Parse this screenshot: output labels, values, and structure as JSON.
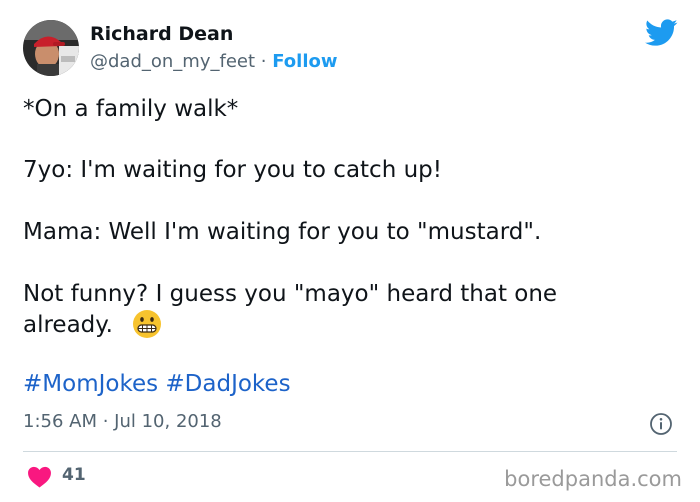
{
  "author": {
    "name": "Richard Dean",
    "handle": "@dad_on_my_feet",
    "separator": " · ",
    "follow_label": "Follow"
  },
  "tweet": {
    "lines": [
      "*On a family walk*",
      "7yo: I'm waiting for you to catch up!",
      "Mama: Well I'm waiting for you to \"mustard\".",
      "Not funny?  I guess you \"mayo\" heard that one",
      "already."
    ],
    "emoji": "grimacing-face-emoji",
    "hashtags": [
      "#MomJokes",
      "#DadJokes"
    ]
  },
  "meta": {
    "timestamp": "1:56 AM · Jul 10, 2018",
    "like_count": "41"
  },
  "icons": {
    "brand": "twitter-bird-icon",
    "info": "info-icon",
    "like": "heart-icon"
  },
  "colors": {
    "accent": "#1d9bf0",
    "hashtag": "#1d63c9",
    "heart": "#f91880",
    "muted": "#536471",
    "watermark": "#9a9a9a"
  },
  "watermark": "boredpanda.com"
}
